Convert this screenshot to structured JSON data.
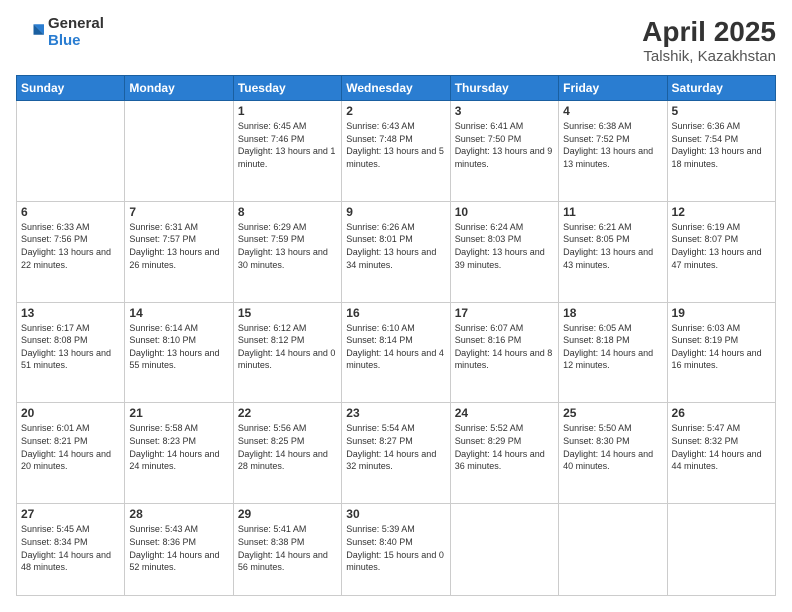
{
  "header": {
    "logo_line1": "General",
    "logo_line2": "Blue",
    "month_year": "April 2025",
    "location": "Talshik, Kazakhstan"
  },
  "weekdays": [
    "Sunday",
    "Monday",
    "Tuesday",
    "Wednesday",
    "Thursday",
    "Friday",
    "Saturday"
  ],
  "weeks": [
    [
      {
        "day": "",
        "info": ""
      },
      {
        "day": "",
        "info": ""
      },
      {
        "day": "1",
        "info": "Sunrise: 6:45 AM\nSunset: 7:46 PM\nDaylight: 13 hours and 1 minute."
      },
      {
        "day": "2",
        "info": "Sunrise: 6:43 AM\nSunset: 7:48 PM\nDaylight: 13 hours and 5 minutes."
      },
      {
        "day": "3",
        "info": "Sunrise: 6:41 AM\nSunset: 7:50 PM\nDaylight: 13 hours and 9 minutes."
      },
      {
        "day": "4",
        "info": "Sunrise: 6:38 AM\nSunset: 7:52 PM\nDaylight: 13 hours and 13 minutes."
      },
      {
        "day": "5",
        "info": "Sunrise: 6:36 AM\nSunset: 7:54 PM\nDaylight: 13 hours and 18 minutes."
      }
    ],
    [
      {
        "day": "6",
        "info": "Sunrise: 6:33 AM\nSunset: 7:56 PM\nDaylight: 13 hours and 22 minutes."
      },
      {
        "day": "7",
        "info": "Sunrise: 6:31 AM\nSunset: 7:57 PM\nDaylight: 13 hours and 26 minutes."
      },
      {
        "day": "8",
        "info": "Sunrise: 6:29 AM\nSunset: 7:59 PM\nDaylight: 13 hours and 30 minutes."
      },
      {
        "day": "9",
        "info": "Sunrise: 6:26 AM\nSunset: 8:01 PM\nDaylight: 13 hours and 34 minutes."
      },
      {
        "day": "10",
        "info": "Sunrise: 6:24 AM\nSunset: 8:03 PM\nDaylight: 13 hours and 39 minutes."
      },
      {
        "day": "11",
        "info": "Sunrise: 6:21 AM\nSunset: 8:05 PM\nDaylight: 13 hours and 43 minutes."
      },
      {
        "day": "12",
        "info": "Sunrise: 6:19 AM\nSunset: 8:07 PM\nDaylight: 13 hours and 47 minutes."
      }
    ],
    [
      {
        "day": "13",
        "info": "Sunrise: 6:17 AM\nSunset: 8:08 PM\nDaylight: 13 hours and 51 minutes."
      },
      {
        "day": "14",
        "info": "Sunrise: 6:14 AM\nSunset: 8:10 PM\nDaylight: 13 hours and 55 minutes."
      },
      {
        "day": "15",
        "info": "Sunrise: 6:12 AM\nSunset: 8:12 PM\nDaylight: 14 hours and 0 minutes."
      },
      {
        "day": "16",
        "info": "Sunrise: 6:10 AM\nSunset: 8:14 PM\nDaylight: 14 hours and 4 minutes."
      },
      {
        "day": "17",
        "info": "Sunrise: 6:07 AM\nSunset: 8:16 PM\nDaylight: 14 hours and 8 minutes."
      },
      {
        "day": "18",
        "info": "Sunrise: 6:05 AM\nSunset: 8:18 PM\nDaylight: 14 hours and 12 minutes."
      },
      {
        "day": "19",
        "info": "Sunrise: 6:03 AM\nSunset: 8:19 PM\nDaylight: 14 hours and 16 minutes."
      }
    ],
    [
      {
        "day": "20",
        "info": "Sunrise: 6:01 AM\nSunset: 8:21 PM\nDaylight: 14 hours and 20 minutes."
      },
      {
        "day": "21",
        "info": "Sunrise: 5:58 AM\nSunset: 8:23 PM\nDaylight: 14 hours and 24 minutes."
      },
      {
        "day": "22",
        "info": "Sunrise: 5:56 AM\nSunset: 8:25 PM\nDaylight: 14 hours and 28 minutes."
      },
      {
        "day": "23",
        "info": "Sunrise: 5:54 AM\nSunset: 8:27 PM\nDaylight: 14 hours and 32 minutes."
      },
      {
        "day": "24",
        "info": "Sunrise: 5:52 AM\nSunset: 8:29 PM\nDaylight: 14 hours and 36 minutes."
      },
      {
        "day": "25",
        "info": "Sunrise: 5:50 AM\nSunset: 8:30 PM\nDaylight: 14 hours and 40 minutes."
      },
      {
        "day": "26",
        "info": "Sunrise: 5:47 AM\nSunset: 8:32 PM\nDaylight: 14 hours and 44 minutes."
      }
    ],
    [
      {
        "day": "27",
        "info": "Sunrise: 5:45 AM\nSunset: 8:34 PM\nDaylight: 14 hours and 48 minutes."
      },
      {
        "day": "28",
        "info": "Sunrise: 5:43 AM\nSunset: 8:36 PM\nDaylight: 14 hours and 52 minutes."
      },
      {
        "day": "29",
        "info": "Sunrise: 5:41 AM\nSunset: 8:38 PM\nDaylight: 14 hours and 56 minutes."
      },
      {
        "day": "30",
        "info": "Sunrise: 5:39 AM\nSunset: 8:40 PM\nDaylight: 15 hours and 0 minutes."
      },
      {
        "day": "",
        "info": ""
      },
      {
        "day": "",
        "info": ""
      },
      {
        "day": "",
        "info": ""
      }
    ]
  ]
}
